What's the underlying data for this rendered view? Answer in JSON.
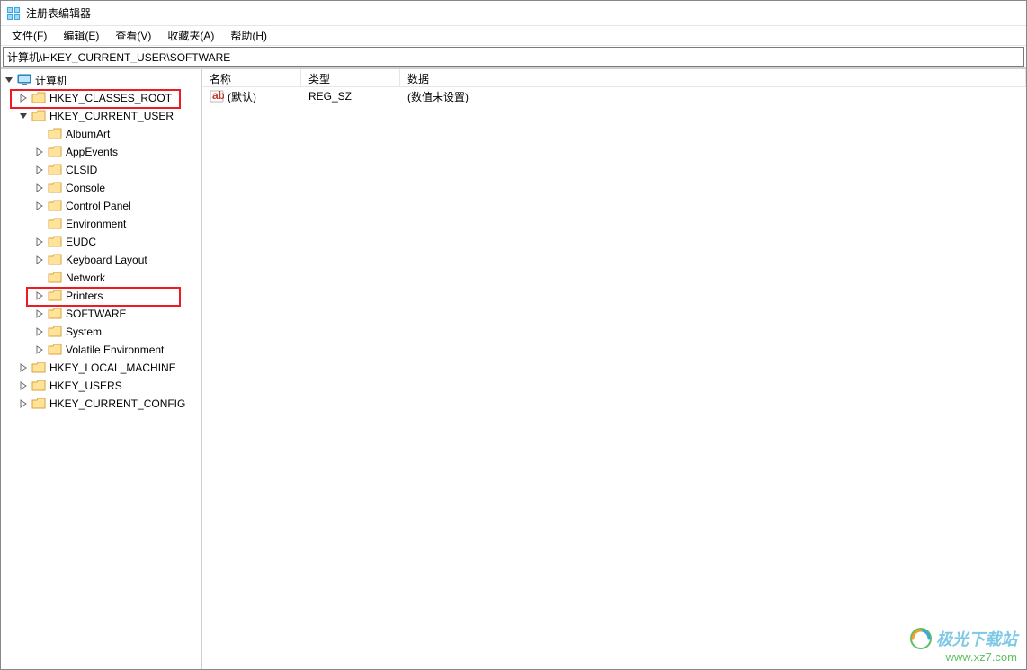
{
  "window": {
    "title": "注册表编辑器"
  },
  "menubar": {
    "file": "文件(F)",
    "edit": "编辑(E)",
    "view": "查看(V)",
    "favorites": "收藏夹(A)",
    "help": "帮助(H)"
  },
  "address": {
    "path": "计算机\\HKEY_CURRENT_USER\\SOFTWARE"
  },
  "tree": {
    "root": "计算机",
    "hives": {
      "hkcr": "HKEY_CLASSES_ROOT",
      "hkcu": "HKEY_CURRENT_USER",
      "hklm": "HKEY_LOCAL_MACHINE",
      "hku": "HKEY_USERS",
      "hkcc": "HKEY_CURRENT_CONFIG"
    },
    "hkcu_children": [
      "AlbumArt",
      "AppEvents",
      "CLSID",
      "Console",
      "Control Panel",
      "Environment",
      "EUDC",
      "Keyboard Layout",
      "Network",
      "Printers",
      "SOFTWARE",
      "System",
      "Volatile Environment"
    ]
  },
  "list": {
    "headers": {
      "name": "名称",
      "type": "类型",
      "data": "数据"
    },
    "rows": [
      {
        "name": "(默认)",
        "type": "REG_SZ",
        "data": "(数值未设置)"
      }
    ]
  },
  "watermark": {
    "title": "极光下载站",
    "url": "www.xz7.com"
  }
}
